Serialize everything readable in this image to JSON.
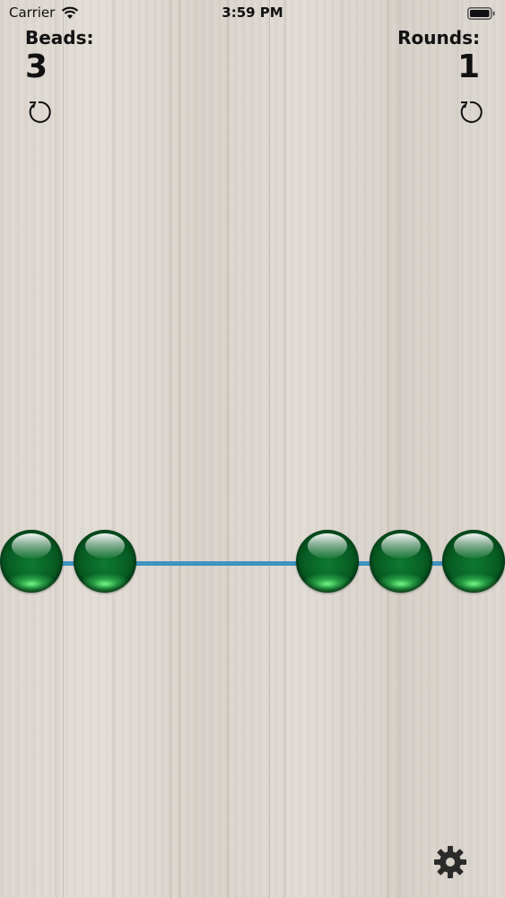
{
  "status_bar": {
    "carrier": "Carrier",
    "time": "3:59 PM",
    "wifi_icon": "wifi-icon",
    "battery_icon": "battery-icon"
  },
  "counters": {
    "beads_label": "Beads:",
    "beads_value": "3",
    "rounds_label": "Rounds:",
    "rounds_value": "1",
    "reset_icon": "reset-icon"
  },
  "abacus": {
    "bead_count": 5,
    "bead_color": "#075a22",
    "string_color": "#3f93bf"
  },
  "settings": {
    "icon": "gear-icon"
  }
}
